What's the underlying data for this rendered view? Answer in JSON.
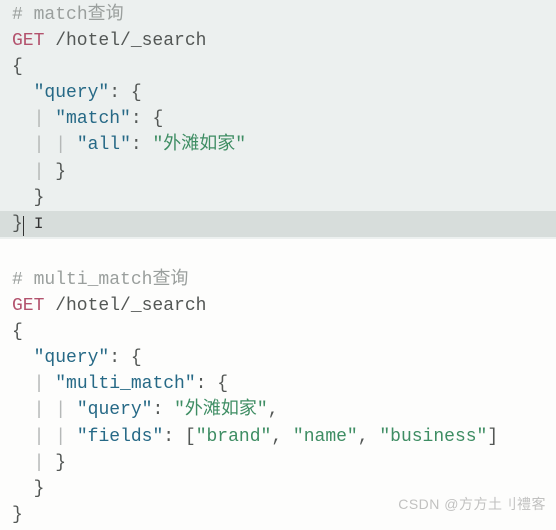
{
  "query1": {
    "comment_prefix": "# ",
    "comment_label": "match",
    "comment_suffix": "查询",
    "method": "GET",
    "path": " /hotel/_search",
    "open_brace": "{",
    "q_key": "\"query\"",
    "q_colon": ": {",
    "match_key": "\"match\"",
    "match_colon": ": {",
    "all_key": "\"all\"",
    "all_colon": ": ",
    "all_value": "\"外滩如家\"",
    "close1": "}",
    "close2": "}",
    "close3": "}"
  },
  "query2": {
    "comment_prefix": "# ",
    "comment_label": "multi_match",
    "comment_suffix": "查询",
    "method": "GET",
    "path": " /hotel/_search",
    "open_brace": "{",
    "q_key": "\"query\"",
    "q_colon": ": {",
    "mm_key": "\"multi_match\"",
    "mm_colon": ": {",
    "qq_key": "\"query\"",
    "qq_colon": ": ",
    "qq_value": "\"外滩如家\"",
    "comma": ",",
    "fields_key": "\"fields\"",
    "fields_colon": ": [",
    "f1": "\"brand\"",
    "sep1": ", ",
    "f2": "\"name\"",
    "sep2": ", ",
    "f3": "\"business\"",
    "fields_end": "]",
    "close1": "}",
    "close2": "}",
    "close3": "}"
  },
  "watermark": "CSDN @方方土刂禮客"
}
